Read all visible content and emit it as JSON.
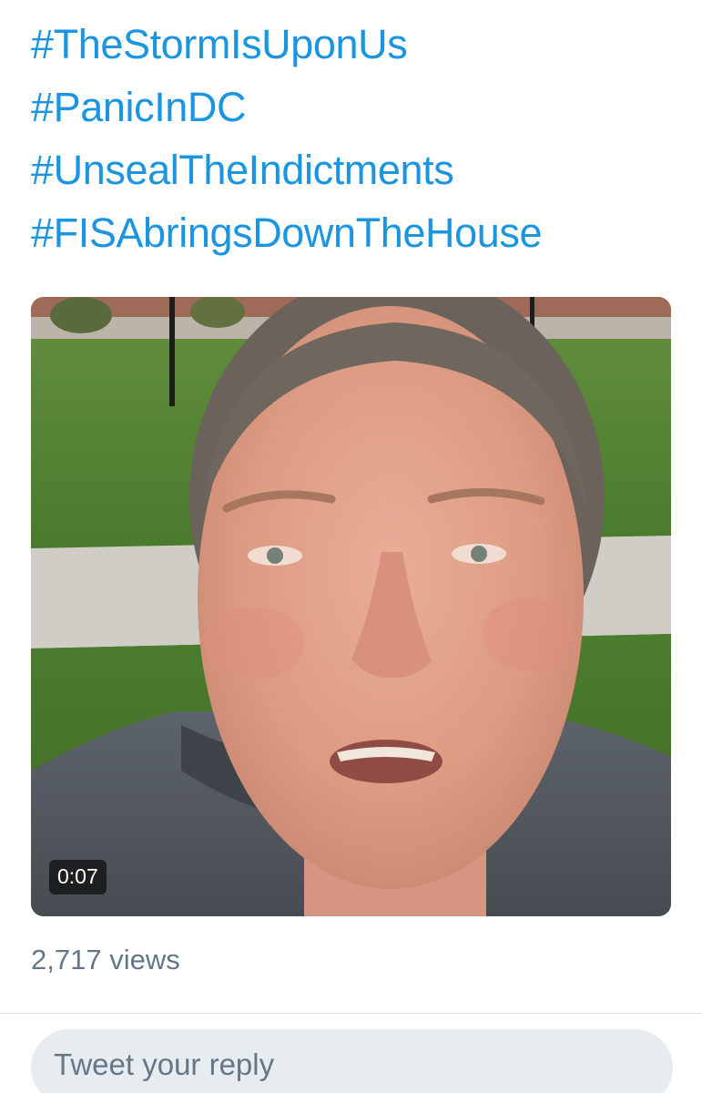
{
  "hashtags": [
    "#TheStormIsUponUs",
    "#PanicInDC",
    "#UnsealTheIndictments",
    "#FISAbringsDownTheHouse"
  ],
  "video": {
    "duration": "0:07"
  },
  "stats": {
    "views": "2,717 views"
  },
  "reply": {
    "placeholder": "Tweet your reply"
  },
  "colors": {
    "link": "#1b95e0",
    "secondary_text": "#657786",
    "reply_bg": "#e6ecf0"
  }
}
